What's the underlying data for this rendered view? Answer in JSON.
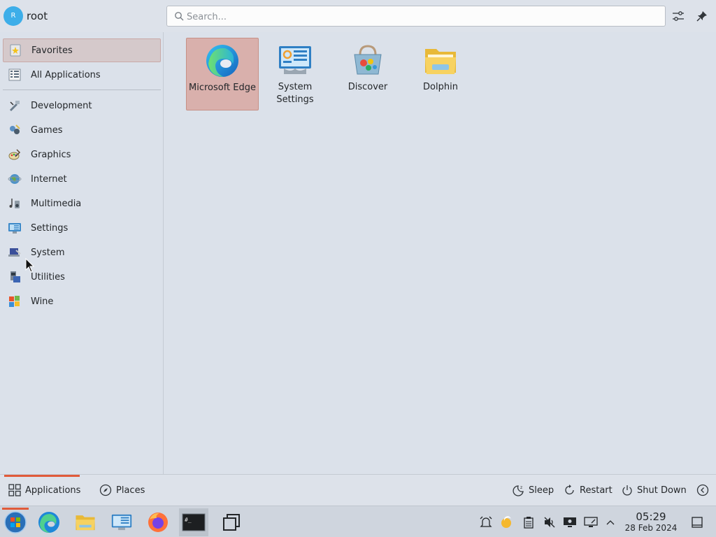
{
  "header": {
    "avatar_initial": "R",
    "username": "root",
    "search_placeholder": "Search...",
    "configure_icon": "sliders-icon",
    "pin_icon": "pin-icon"
  },
  "sidebar": {
    "items": [
      {
        "label": "Favorites",
        "icon": "star-doc-icon",
        "selected": true
      },
      {
        "label": "All Applications",
        "icon": "grid-list-icon"
      },
      {
        "label": "Development",
        "icon": "development-icon"
      },
      {
        "label": "Games",
        "icon": "games-icon"
      },
      {
        "label": "Graphics",
        "icon": "graphics-icon"
      },
      {
        "label": "Internet",
        "icon": "internet-icon"
      },
      {
        "label": "Multimedia",
        "icon": "multimedia-icon"
      },
      {
        "label": "Settings",
        "icon": "settings-icon"
      },
      {
        "label": "System",
        "icon": "system-icon"
      },
      {
        "label": "Utilities",
        "icon": "utilities-icon"
      },
      {
        "label": "Wine",
        "icon": "wine-icon"
      }
    ]
  },
  "apps": [
    {
      "label": "Microsoft Edge",
      "icon": "edge-icon",
      "selected": true
    },
    {
      "label": "System Settings",
      "icon": "system-settings-icon"
    },
    {
      "label": "Discover",
      "icon": "discover-icon"
    },
    {
      "label": "Dolphin",
      "icon": "dolphin-folder-icon"
    }
  ],
  "footer": {
    "tabs": [
      {
        "label": "Applications",
        "icon": "applications-grid-icon",
        "active": true
      },
      {
        "label": "Places",
        "icon": "compass-icon"
      }
    ],
    "actions": [
      {
        "label": "Sleep",
        "icon": "sleep-icon"
      },
      {
        "label": "Restart",
        "icon": "restart-icon"
      },
      {
        "label": "Shut Down",
        "icon": "power-icon"
      }
    ],
    "more_icon": "chevron-left-circle-icon"
  },
  "taskbar": {
    "launcher_icon": "start-menu-icon",
    "apps": [
      "edge-icon",
      "file-manager-icon",
      "system-settings-icon",
      "firefox-icon",
      "terminal-icon",
      "window-switcher-icon"
    ],
    "tray": [
      "alarm-icon",
      "weather-icon",
      "clipboard-icon",
      "volume-muted-icon",
      "display-icon",
      "network-icon",
      "expand-tray-icon"
    ],
    "clock_time": "05:29",
    "clock_date": "28 Feb 2024",
    "show_desktop_icon": "show-desktop-icon"
  },
  "colors": {
    "accent": "#e05a3a",
    "selection": "#d9b0ac",
    "background": "#dbe1ea"
  }
}
